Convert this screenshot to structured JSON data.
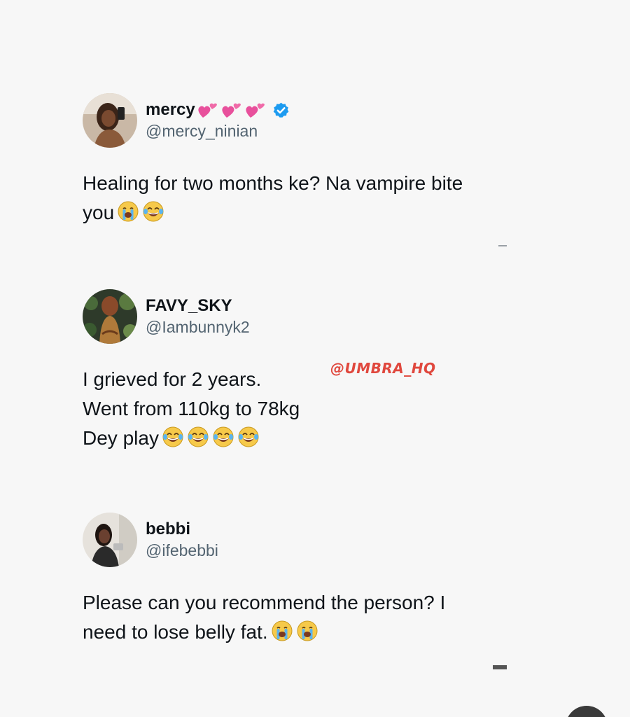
{
  "tweets": [
    {
      "display_name": "mercy",
      "handle": "@mercy_ninian",
      "verified": true,
      "text": "Healing for two months ke? Na vampire bite\nyou",
      "emojis": [
        "loudly-crying-face",
        "tears-of-joy-face"
      ]
    },
    {
      "display_name": "FAVY_SKY",
      "handle": "@Iambunnyk2",
      "verified": false,
      "text": "I grieved for 2 years.\nWent from 110kg to 78kg\nDey play",
      "emojis": [
        "tears-of-joy-face",
        "tears-of-joy-face",
        "tears-of-joy-face",
        "tears-of-joy-face"
      ]
    },
    {
      "display_name": "bebbi",
      "handle": "@ifebebbi",
      "verified": false,
      "text": "Please can you recommend the person? I\nneed to lose belly fat.",
      "emojis": [
        "loudly-crying-face",
        "loudly-crying-face"
      ]
    }
  ],
  "watermark": "@UMBRA_HQ",
  "colors": {
    "background": "#f7f7f7",
    "text": "#0f1419",
    "handle": "#536471",
    "verified": "#1d9bf0",
    "watermark": "#e0483e",
    "heart": "#e8509c"
  }
}
